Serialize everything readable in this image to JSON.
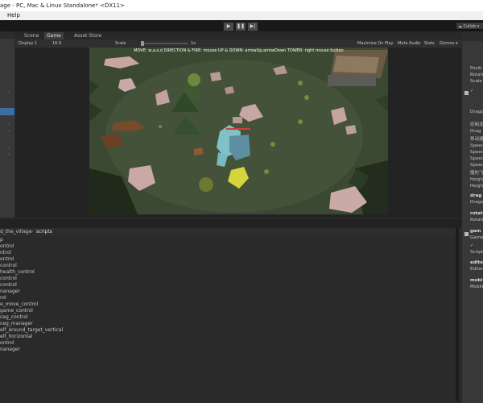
{
  "window": {
    "title": "age - PC, Mac & Linux Standalone* <DX11>"
  },
  "menu": {
    "help": "Help"
  },
  "toolbar": {
    "play": "▶",
    "pause": "❚❚",
    "step": "▶|",
    "collab": "Collab ▾"
  },
  "tabs": {
    "scene": "Scene",
    "game": "Game",
    "asset_store": "Asset Store"
  },
  "gamebar": {
    "display": "Display 1",
    "aspect": "16:9",
    "scale_label": "Scale",
    "scale_value": "1x",
    "maximize": "Maximize On Play",
    "mute": "Mute Audio",
    "stats": "Stats",
    "gizmos": "Gizmos ▾"
  },
  "hud": {
    "text": "MOVE: w,a,s,d    DIRECTION & FIRE: mouse    UP & DOWN: arrowUp,arrowDown    TOWER: right mouse button"
  },
  "project": {
    "breadcrumb_parent": "d_the_village",
    "breadcrumb_current": "scripts",
    "files": [
      "p",
      "ontrol",
      "ntrol",
      "ontrol",
      "control",
      "health_control",
      "control",
      "control",
      "nanager",
      "rol",
      "e_move_control",
      "game_control",
      "ceg_control",
      "ceg_manager",
      "elf_around_target_vertical",
      "elf_horizontal",
      "ontrol",
      "nanager"
    ]
  },
  "inspector": {
    "items": [
      {
        "text": "Positi",
        "bold": false
      },
      {
        "text": "Rotati",
        "bold": false
      },
      {
        "text": "Scale",
        "bold": false
      },
      {
        "text": "✓",
        "bold": false
      },
      {
        "text": "Drago",
        "bold": false
      },
      {
        "text": "控制龙",
        "bold": false
      },
      {
        "text": "Drag",
        "bold": false
      },
      {
        "text": "移动速",
        "bold": false
      },
      {
        "text": "Speed",
        "bold": false
      },
      {
        "text": "Speed",
        "bold": false
      },
      {
        "text": "Speed",
        "bold": false
      },
      {
        "text": "Speed",
        "bold": false
      },
      {
        "text": "龍的飞",
        "bold": false
      },
      {
        "text": "Heigh",
        "bold": false
      },
      {
        "text": "Heigh",
        "bold": false
      },
      {
        "text": "drag",
        "bold": true
      },
      {
        "text": "Drago",
        "bold": false
      },
      {
        "text": "rotat",
        "bold": true
      },
      {
        "text": "Rotati",
        "bold": false
      },
      {
        "text": "gam",
        "bold": true
      },
      {
        "text": "Game",
        "bold": false
      },
      {
        "text": "✓",
        "bold": false
      },
      {
        "text": "Script",
        "bold": false
      },
      {
        "text": "edito",
        "bold": true
      },
      {
        "text": "Editor",
        "bold": false
      },
      {
        "text": "mobi",
        "bold": true
      },
      {
        "text": "Mobile",
        "bold": false
      }
    ]
  },
  "colors": {
    "selection": "#3d6ea1",
    "panel": "#383838",
    "ground": "#3b4832"
  }
}
